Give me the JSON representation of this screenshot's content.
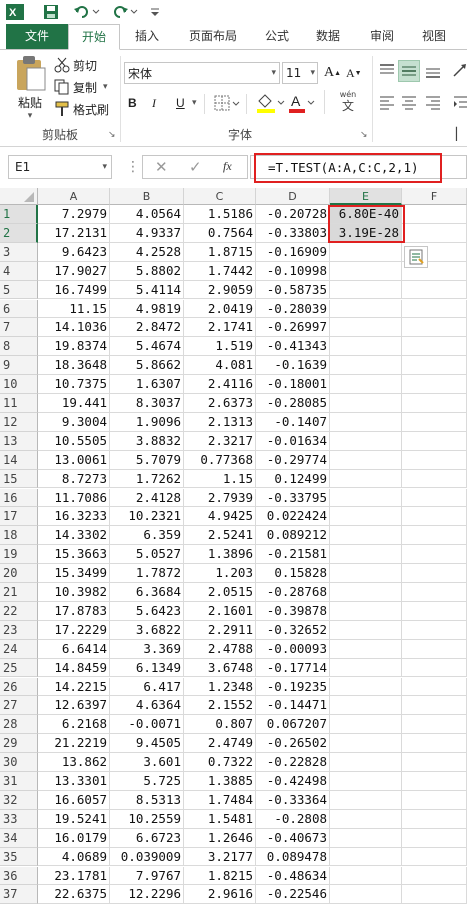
{
  "qat": {
    "icons": [
      "excel-icon",
      "save-icon",
      "undo-icon",
      "redo-icon",
      "customize-icon"
    ]
  },
  "tabs": [
    "文件",
    "开始",
    "插入",
    "页面布局",
    "公式",
    "数据",
    "审阅",
    "视图"
  ],
  "clipboard": {
    "paste": "粘贴",
    "cut": "剪切",
    "copy": "复制",
    "format_painter": "格式刷",
    "label": "剪贴板"
  },
  "font": {
    "name": "宋体",
    "size": "11",
    "label": "字体",
    "bold": "B",
    "italic": "I",
    "underline": "U",
    "wen": "wén",
    "wen2": "文"
  },
  "namebox": "E1",
  "formula": "=T.TEST(A:A,C:C,2,1)",
  "fx": "fx",
  "columns": [
    "A",
    "B",
    "C",
    "D",
    "E",
    "F"
  ],
  "rows": [
    [
      "1",
      "7.2979",
      "4.0564",
      "1.5186",
      "-0.20728",
      "6.80E-40"
    ],
    [
      "2",
      "17.2131",
      "4.9337",
      "0.7564",
      "-0.33803",
      "3.19E-28"
    ],
    [
      "3",
      "9.6423",
      "4.2528",
      "1.8715",
      "-0.16909",
      ""
    ],
    [
      "4",
      "17.9027",
      "5.8802",
      "1.7442",
      "-0.10998",
      ""
    ],
    [
      "5",
      "16.7499",
      "5.4114",
      "2.9059",
      "-0.58735",
      ""
    ],
    [
      "6",
      "11.15",
      "4.9819",
      "2.0419",
      "-0.28039",
      ""
    ],
    [
      "7",
      "14.1036",
      "2.8472",
      "2.1741",
      "-0.26997",
      ""
    ],
    [
      "8",
      "19.8374",
      "5.4674",
      "1.519",
      "-0.41343",
      ""
    ],
    [
      "9",
      "18.3648",
      "5.8662",
      "4.081",
      "-0.1639",
      ""
    ],
    [
      "10",
      "10.7375",
      "1.6307",
      "2.4116",
      "-0.18001",
      ""
    ],
    [
      "11",
      "19.441",
      "8.3037",
      "2.6373",
      "-0.28085",
      ""
    ],
    [
      "12",
      "9.3004",
      "1.9096",
      "2.1313",
      "-0.1407",
      ""
    ],
    [
      "13",
      "10.5505",
      "3.8832",
      "2.3217",
      "-0.01634",
      ""
    ],
    [
      "14",
      "13.0061",
      "5.7079",
      "0.77368",
      "-0.29774",
      ""
    ],
    [
      "15",
      "8.7273",
      "1.7262",
      "1.15",
      "0.12499",
      ""
    ],
    [
      "16",
      "11.7086",
      "2.4128",
      "2.7939",
      "-0.33795",
      ""
    ],
    [
      "17",
      "16.3233",
      "10.2321",
      "4.9425",
      "0.022424",
      ""
    ],
    [
      "18",
      "14.3302",
      "6.359",
      "2.5241",
      "0.089212",
      ""
    ],
    [
      "19",
      "15.3663",
      "5.0527",
      "1.3896",
      "-0.21581",
      ""
    ],
    [
      "20",
      "15.3499",
      "1.7872",
      "1.203",
      "0.15828",
      ""
    ],
    [
      "21",
      "10.3982",
      "6.3684",
      "2.0515",
      "-0.28768",
      ""
    ],
    [
      "22",
      "17.8783",
      "5.6423",
      "2.1601",
      "-0.39878",
      ""
    ],
    [
      "23",
      "17.2229",
      "3.6822",
      "2.2911",
      "-0.32652",
      ""
    ],
    [
      "24",
      "6.6414",
      "3.369",
      "2.4788",
      "-0.00093",
      ""
    ],
    [
      "25",
      "14.8459",
      "6.1349",
      "3.6748",
      "-0.17714",
      ""
    ],
    [
      "26",
      "14.2215",
      "6.417",
      "1.2348",
      "-0.19235",
      ""
    ],
    [
      "27",
      "12.6397",
      "4.6364",
      "2.1552",
      "-0.14471",
      ""
    ],
    [
      "28",
      "6.2168",
      "-0.0071",
      "0.807",
      "0.067207",
      ""
    ],
    [
      "29",
      "21.2219",
      "9.4505",
      "2.4749",
      "-0.26502",
      ""
    ],
    [
      "30",
      "13.862",
      "3.601",
      "0.7322",
      "-0.22828",
      ""
    ],
    [
      "31",
      "13.3301",
      "5.725",
      "1.3885",
      "-0.42498",
      ""
    ],
    [
      "32",
      "16.6057",
      "8.5313",
      "1.7484",
      "-0.33364",
      ""
    ],
    [
      "33",
      "19.5241",
      "10.2559",
      "1.5481",
      "-0.2808",
      ""
    ],
    [
      "34",
      "16.0179",
      "6.6723",
      "1.2646",
      "-0.40673",
      ""
    ],
    [
      "35",
      "4.0689",
      "0.039009",
      "3.2177",
      "0.089478",
      ""
    ],
    [
      "36",
      "23.1781",
      "7.9767",
      "1.8215",
      "-0.48634",
      ""
    ],
    [
      "37",
      "22.6375",
      "12.2296",
      "2.9616",
      "-0.22546",
      ""
    ]
  ],
  "colors": {
    "accent": "#217346",
    "highlight": "#e02020",
    "selected_fill": "#d9d9d9"
  }
}
